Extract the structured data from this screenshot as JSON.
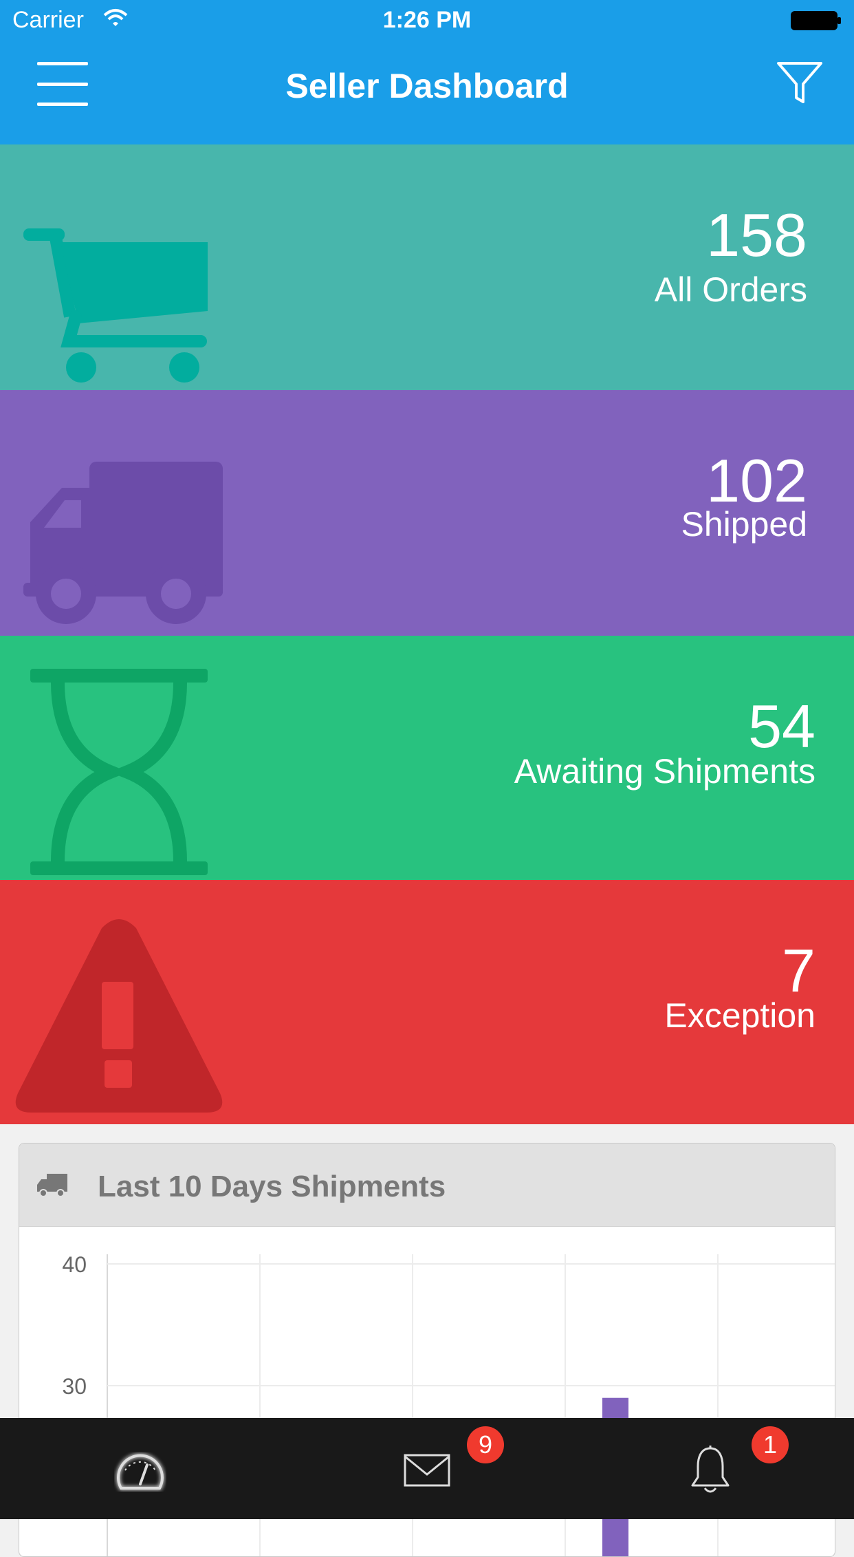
{
  "status_bar": {
    "carrier": "Carrier",
    "time": "1:26 PM"
  },
  "navbar": {
    "title": "Seller Dashboard",
    "menu_icon": "hamburger-menu-icon",
    "filter_icon": "filter-funnel-icon"
  },
  "tiles": [
    {
      "count": "158",
      "label": "All Orders",
      "icon": "shopping-cart-icon",
      "color": "#48b6ac"
    },
    {
      "count": "102",
      "label": "Shipped",
      "icon": "truck-icon",
      "color": "#8162bd"
    },
    {
      "count": "54",
      "label": "Awaiting Shipments",
      "icon": "hourglass-icon",
      "color": "#28c27f"
    },
    {
      "count": "7",
      "label": "Exception",
      "icon": "warning-triangle-icon",
      "color": "#e5393b"
    }
  ],
  "panel": {
    "title": "Last 10 Days Shipments",
    "icon": "truck-icon"
  },
  "chart_data": {
    "type": "bar",
    "title": "Last 10 Days Shipments",
    "y_ticks": [
      40,
      30
    ],
    "ylim_visible": [
      26,
      40
    ],
    "visible_bar_top": 29,
    "visible_bar_color": "#8162bd"
  },
  "tabbar": {
    "tabs": [
      {
        "icon": "dashboard-gauge-icon",
        "badge": null
      },
      {
        "icon": "mail-envelope-icon",
        "badge": "9"
      },
      {
        "icon": "notification-bell-icon",
        "badge": "1"
      }
    ]
  }
}
